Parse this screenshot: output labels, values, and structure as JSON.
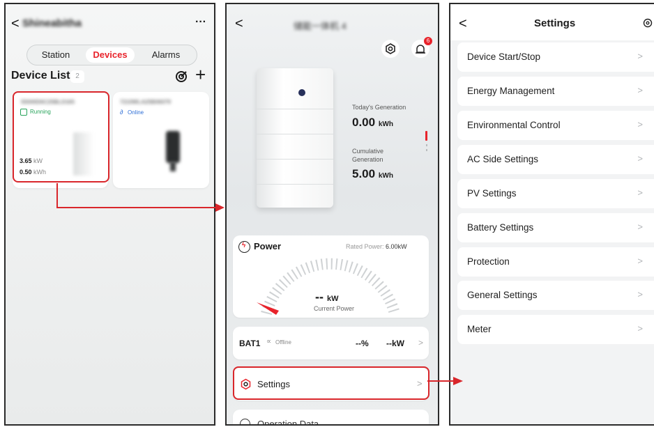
{
  "colors": {
    "accent_red": "#e8232b",
    "running_green": "#27a35a",
    "online_blue": "#2f6fd6",
    "callout_red": "#d9262b"
  },
  "panel1": {
    "back_label": "<",
    "station_name": "Shineabitha",
    "more_label": "···",
    "tabs": [
      {
        "label": "Station"
      },
      {
        "label": "Devices",
        "active": true
      },
      {
        "label": "Alarms"
      }
    ],
    "device_list_title": "Device List",
    "device_count": "2",
    "add_label": "+",
    "devices": [
      {
        "serial": "55000D6C25BLD165",
        "status": "Running",
        "power": "3.65",
        "power_unit": "kW",
        "energy": "0.50",
        "energy_unit": "kWh"
      },
      {
        "serial": "7210WLA25B06079",
        "status": "Online"
      }
    ]
  },
  "panel2": {
    "back_label": "<",
    "device_title": "储能一体机 4",
    "alarm_badge": "6",
    "today_generation_label": "Today's Generation",
    "today_generation_value": "0.00",
    "today_generation_unit": "kWh",
    "cumulative_label_line1": "Cumulative",
    "cumulative_label_line2": "Generation",
    "cumulative_value": "5.00",
    "cumulative_unit": "kWh",
    "power_card": {
      "title": "Power",
      "rated_label": "Rated Power:",
      "rated_value": "6.00kW",
      "current_value": "--",
      "current_unit": "kW",
      "current_label": "Current Power"
    },
    "battery": {
      "name": "BAT1",
      "status": "Offline",
      "soc": "--%",
      "power": "--kW",
      "chevron": ">"
    },
    "settings_item": {
      "label": "Settings",
      "chevron": ">"
    },
    "next_item": {
      "label": "Operation Data"
    }
  },
  "panel3": {
    "back_label": "<",
    "title": "Settings",
    "items": [
      {
        "label": "Device Start/Stop",
        "chevron": ">"
      },
      {
        "label": "Energy Management",
        "chevron": ">"
      },
      {
        "label": "Environmental Control",
        "chevron": ">"
      },
      {
        "label": "AC Side Settings",
        "chevron": ">"
      },
      {
        "label": "PV Settings",
        "chevron": ">"
      },
      {
        "label": "Battery Settings",
        "chevron": ">"
      },
      {
        "label": "Protection",
        "chevron": ">"
      },
      {
        "label": "General Settings",
        "chevron": ">"
      },
      {
        "label": "Meter",
        "chevron": ">"
      }
    ]
  }
}
